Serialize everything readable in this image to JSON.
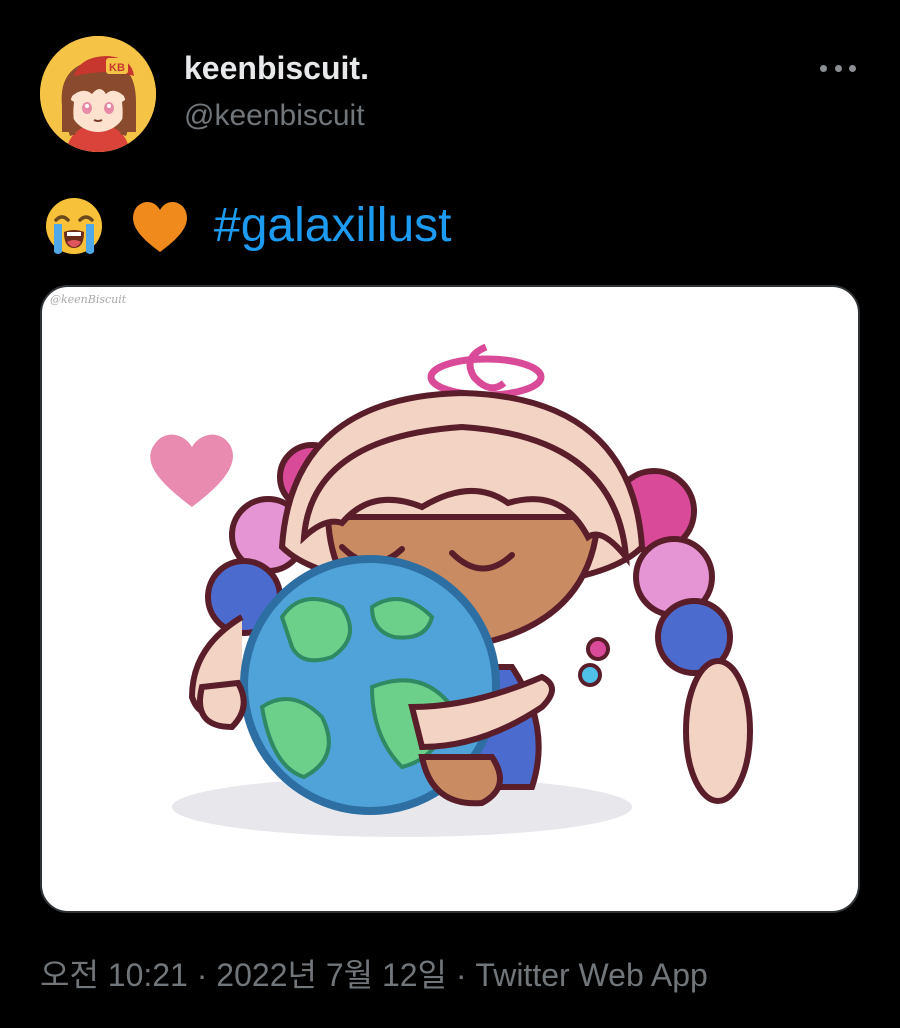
{
  "user": {
    "display_name": "keenbiscuit.",
    "handle": "@keenbiscuit"
  },
  "tweet": {
    "emojis": [
      "loudly-crying-face",
      "orange-heart"
    ],
    "hashtag": "#galaxillust"
  },
  "media": {
    "watermark": "@keenBiscuit"
  },
  "meta": {
    "time": "오전 10:21",
    "separator1": " · ",
    "date": "2022년 7월 12일",
    "separator2": " · ",
    "source": "Twitter Web App"
  },
  "colors": {
    "background": "#000000",
    "text_primary": "#e7e9ea",
    "text_secondary": "#71767b",
    "link": "#1d9bf0"
  },
  "icons": {
    "more": "more-dots-icon"
  }
}
